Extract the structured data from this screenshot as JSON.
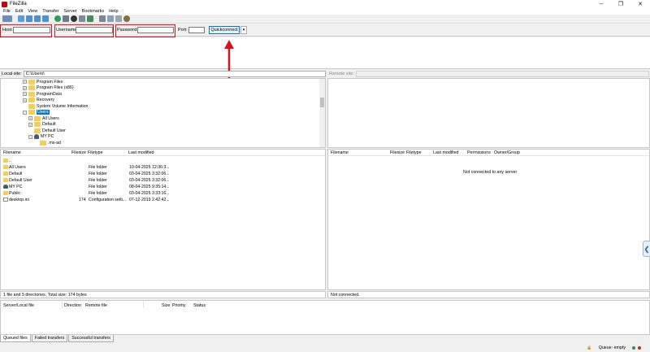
{
  "window": {
    "title": "FileZilla",
    "minimize": "─",
    "maximize": "❐",
    "close": "✕"
  },
  "menu": [
    "File",
    "Edit",
    "View",
    "Transfer",
    "Server",
    "Bookmarks",
    "Help"
  ],
  "toolbar": {
    "icons": [
      "site-manager-icon",
      "toggle-message-log-icon",
      "toggle-local-tree-icon",
      "toggle-remote-tree-icon",
      "toggle-queue-icon",
      "refresh-icon",
      "process-queue-icon",
      "cancel-icon",
      "disconnect-icon",
      "reconnect-icon",
      "directory-listing-filters-icon",
      "toggle-comparison-icon",
      "synchronized-browsing-icon",
      "search-remote-files-icon"
    ]
  },
  "quickconnect": {
    "host_label": "Host:",
    "host_value": "",
    "username_label": "Username:",
    "username_value": "",
    "password_label": "Password:",
    "password_value": "",
    "port_label": "Port:",
    "port_value": "",
    "button_label": "Quickconnect",
    "dropdown_glyph": "▾",
    "highlight_color": "#d8131f"
  },
  "local_site": {
    "label": "Local site:",
    "path": "C:\\Users\\"
  },
  "remote_site": {
    "label": "Remote site:",
    "path": ""
  },
  "local_tree": [
    {
      "label": "Program Files",
      "type": "folder",
      "expander": "+"
    },
    {
      "label": "Program Files (x86)",
      "type": "folder",
      "expander": "+"
    },
    {
      "label": "ProgramData",
      "type": "folder",
      "expander": "+"
    },
    {
      "label": "Recovery",
      "type": "folder",
      "expander": "+"
    },
    {
      "label": "System Volume Information",
      "type": "folder",
      "expander": ""
    },
    {
      "label": "Users",
      "type": "folder",
      "expander": "−",
      "selected": true
    },
    {
      "label": "All Users",
      "type": "folder",
      "expander": "+"
    },
    {
      "label": "Default",
      "type": "folder",
      "expander": "+"
    },
    {
      "label": "Default User",
      "type": "folder",
      "expander": ""
    },
    {
      "label": "MY PC",
      "type": "user",
      "expander": "−"
    },
    {
      "label": ".ms-ad",
      "type": "folder",
      "expander": ""
    }
  ],
  "local_files": {
    "headers": {
      "name": "Filename",
      "size": "Filesize",
      "type": "Filetype",
      "modified": "Last modified"
    },
    "rows": [
      {
        "name": "..",
        "size": "",
        "type": "",
        "modified": "",
        "icon": "folder"
      },
      {
        "name": "All Users",
        "size": "",
        "type": "File folder",
        "modified": "10-04-2025 12:36:3...",
        "icon": "folder"
      },
      {
        "name": "Default",
        "size": "",
        "type": "File folder",
        "modified": "03-04-2025 3:32:06...",
        "icon": "folder"
      },
      {
        "name": "Default User",
        "size": "",
        "type": "File folder",
        "modified": "03-04-2025 3:32:06...",
        "icon": "folder"
      },
      {
        "name": "MY PC",
        "size": "",
        "type": "File folder",
        "modified": "08-04-2025 9:35:14...",
        "icon": "user"
      },
      {
        "name": "Public",
        "size": "",
        "type": "File folder",
        "modified": "03-04-2025 3:33:16...",
        "icon": "folder"
      },
      {
        "name": "desktop.ini",
        "size": "174",
        "type": "Configuration setti...",
        "modified": "07-12-2019 2:42:42...",
        "icon": "file"
      }
    ],
    "status": "1 file and 5 directories. Total size: 174 bytes"
  },
  "remote_files": {
    "headers": {
      "name": "Filename",
      "size": "Filesize",
      "type": "Filetype",
      "modified": "Last modified",
      "permissions": "Permissions",
      "owner": "Owner/Group"
    },
    "empty_message": "Not connected to any server",
    "status": "Not connected."
  },
  "queue": {
    "headers": [
      "Server/Local file",
      "Direction",
      "Remote file",
      "Size",
      "Priority",
      "Status"
    ],
    "tabs": [
      "Queued files",
      "Failed transfers",
      "Successful transfers"
    ],
    "status": "Queue: empty"
  },
  "side_tab_glyph": "❮"
}
